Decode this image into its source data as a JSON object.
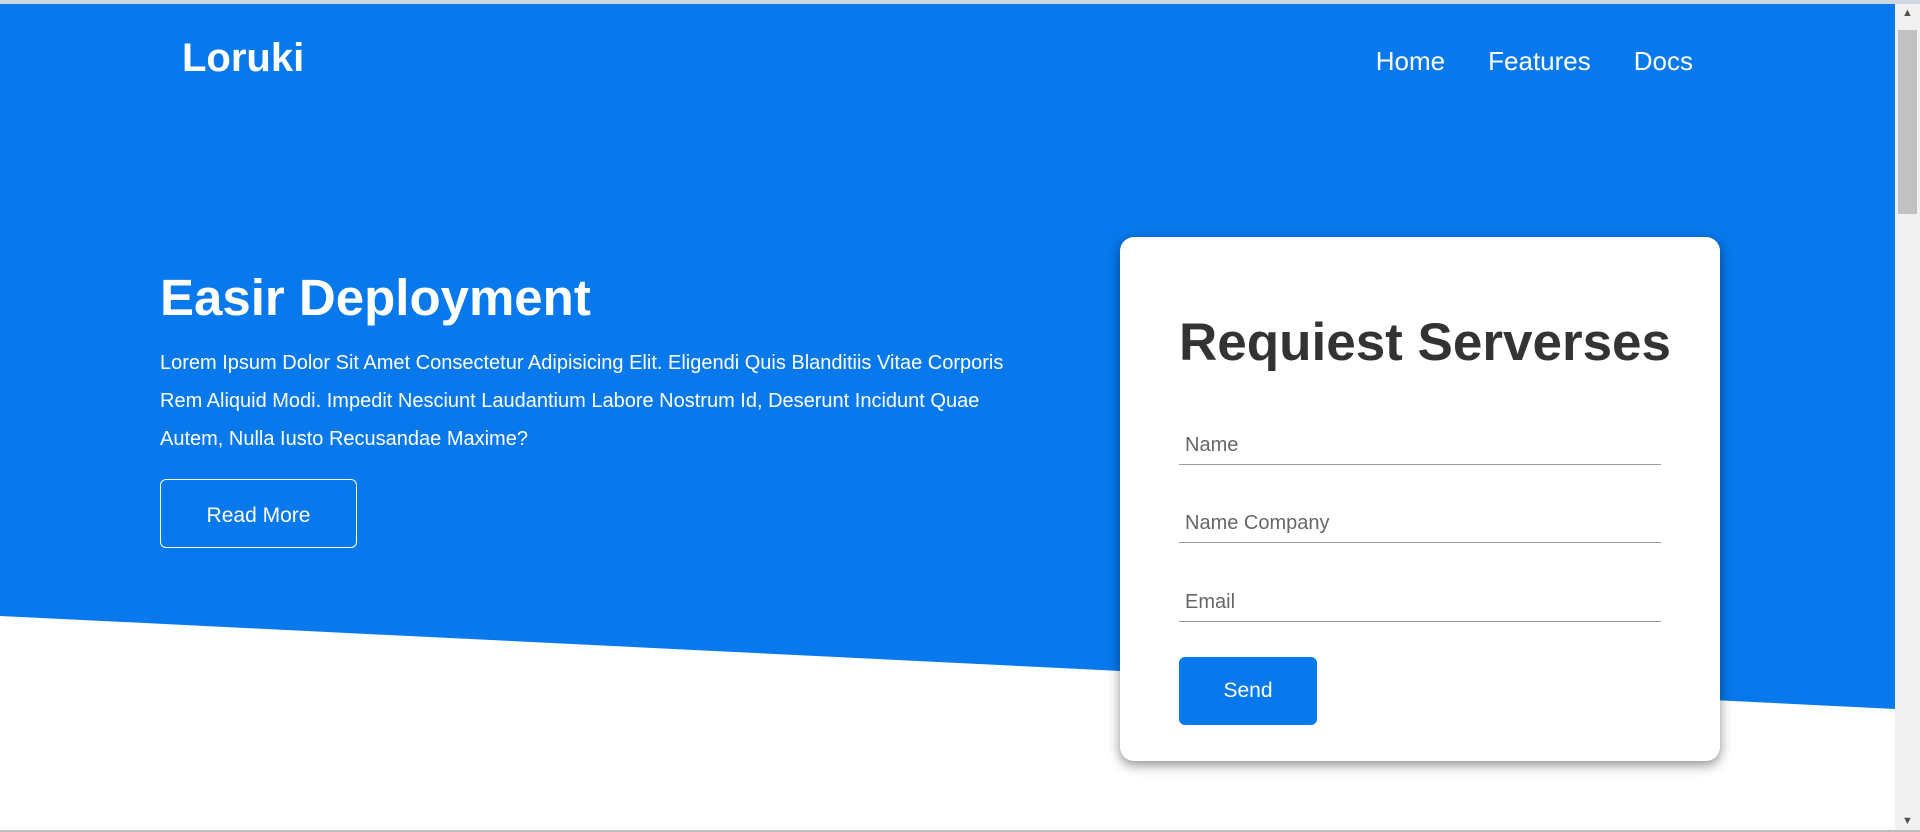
{
  "colors": {
    "hero_bg": "#0779ec",
    "hero_text": "#ffffff",
    "form_title": "#333333",
    "input_text": "#666666",
    "send_button": "#0779ec"
  },
  "nav": {
    "logo": "Loruki",
    "links": [
      "Home",
      "Features",
      "Docs"
    ]
  },
  "hero": {
    "title": "Easir Deployment",
    "text": "Lorem Ipsum Dolor Sit Amet Consectetur Adipisicing Elit. Eligendi Quis Blanditiis Vitae Corporis Rem Aliquid Modi. Impedit Nesciunt Laudantium Labore Nostrum Id, Deserunt Incidunt Quae Autem, Nulla Iusto Recusandae Maxime?",
    "read_more_label": "Read More"
  },
  "form": {
    "title": "Requiest Serverses",
    "fields": {
      "name_placeholder": "Name",
      "company_placeholder": "Name Company",
      "email_placeholder": "Email"
    },
    "send_label": "Send"
  },
  "icons": {
    "scroll_up": "scroll-up-arrow-icon",
    "scroll_down": "scroll-down-arrow-icon"
  }
}
